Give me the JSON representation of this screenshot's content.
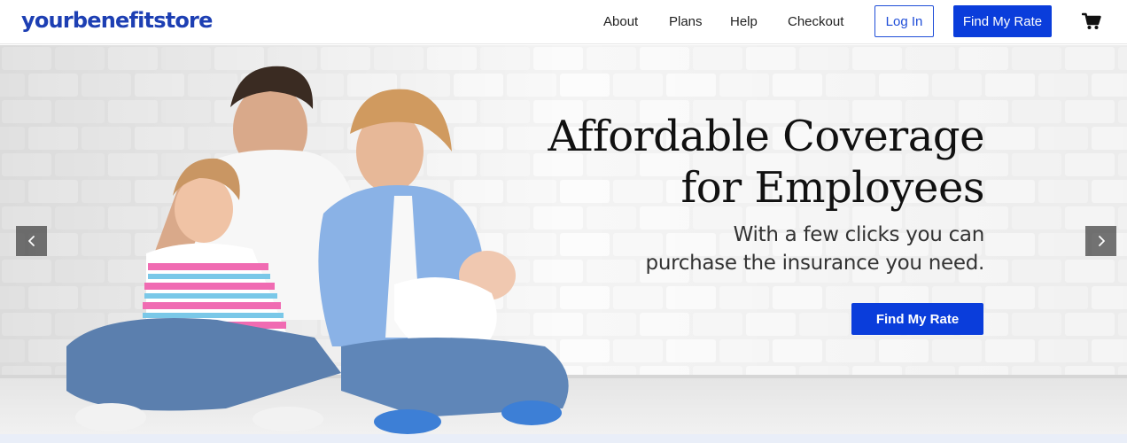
{
  "brand": {
    "logo": "yourbenefitstore",
    "accent": "#1d3fb3",
    "button_color": "#0a3ddb"
  },
  "nav": {
    "links": [
      "About",
      "Plans",
      "Help",
      "Checkout"
    ],
    "login_label": "Log In",
    "find_rate_label": "Find My Rate",
    "cart_icon": "shopping-cart-icon"
  },
  "hero": {
    "title_line1": "Affordable Coverage",
    "title_line2": "for Employees",
    "subtitle_line1": "With a few clicks you can",
    "subtitle_line2": "purchase the insurance you need.",
    "cta_label": "Find My Rate",
    "prev_icon": "chevron-left-icon",
    "next_icon": "chevron-right-icon",
    "image": "family-photo"
  }
}
